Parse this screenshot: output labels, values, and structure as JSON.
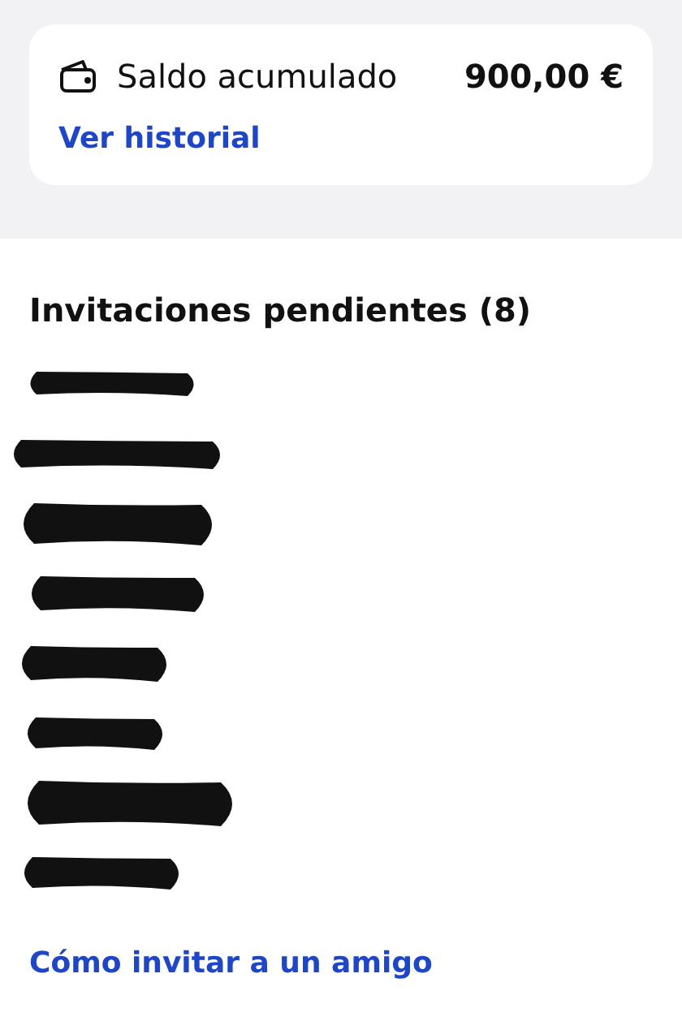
{
  "balance_card": {
    "label": "Saldo acumulado",
    "amount": "900,00 €",
    "link": "Ver historial"
  },
  "invitations": {
    "title": "Invitaciones pendientes (8)",
    "items": [
      {
        "kind": "redacted"
      },
      {
        "kind": "redacted"
      },
      {
        "kind": "redacted"
      },
      {
        "kind": "redacted"
      },
      {
        "kind": "redacted"
      },
      {
        "kind": "redacted"
      },
      {
        "kind": "redacted"
      },
      {
        "kind": "redacted"
      }
    ]
  },
  "footer_link": "Cómo invitar a un amigo"
}
